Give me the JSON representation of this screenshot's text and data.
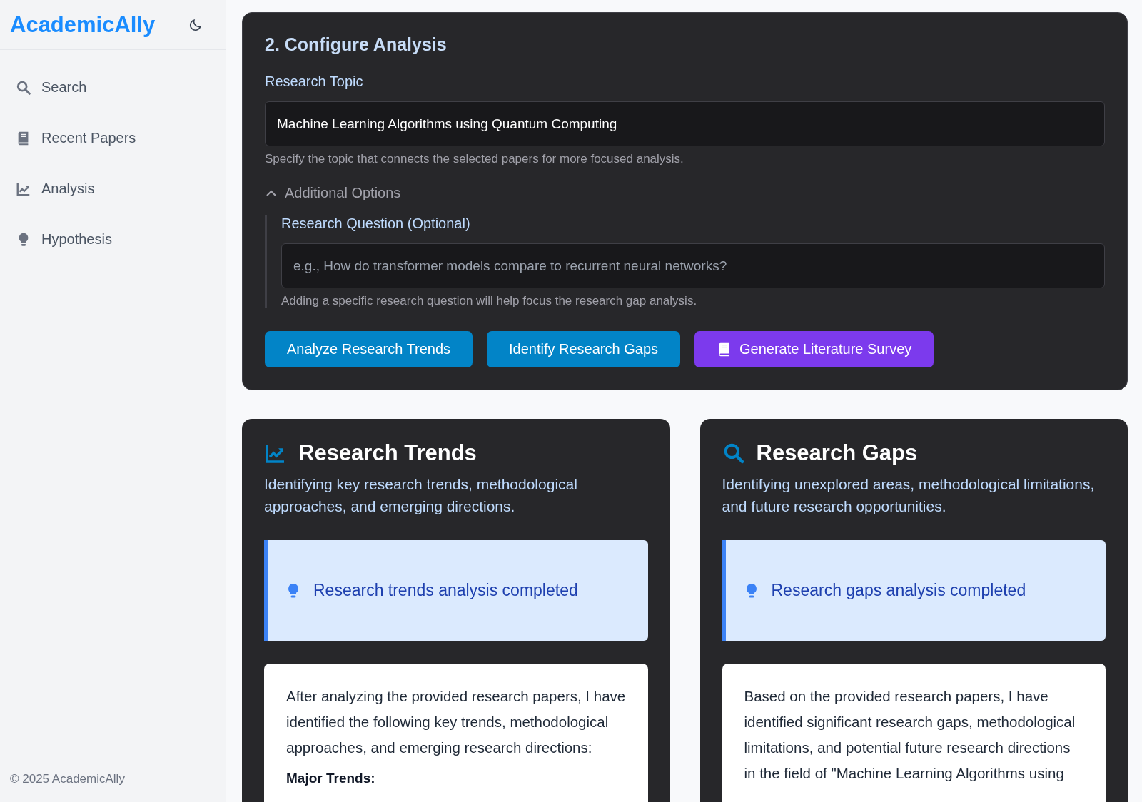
{
  "sidebar": {
    "brand": "AcademicAlly",
    "theme_toggle": {
      "dark": false
    },
    "items": [
      {
        "label": "Search",
        "kind": "search",
        "selected": false
      },
      {
        "label": "Recent Papers",
        "kind": "papers",
        "selected": false
      },
      {
        "label": "Analysis",
        "kind": "analysis",
        "selected": false
      },
      {
        "label": "Hypothesis",
        "kind": "hypothesis",
        "selected": false
      }
    ],
    "footer": "© 2025 AcademicAlly"
  },
  "configure": {
    "title": "2. Configure Analysis",
    "topic_label": "Research Topic",
    "topic_value": "Machine Learning Algorithms using Quantum Computing",
    "topic_help": "Specify the topic that connects the selected papers for more focused analysis.",
    "options": {
      "label": "Additional Options",
      "expanded": true,
      "question_label": "Research Question (Optional)",
      "question_placeholder": "e.g., How do transformer models compare to recurrent neural networks?",
      "question_help": "Adding a specific research question will help focus the research gap analysis."
    },
    "buttons": [
      {
        "label": "Analyze Research Trends",
        "kind": "primary"
      },
      {
        "label": "Identify Research Gaps",
        "kind": "primary"
      },
      {
        "label": "Generate Literature Survey",
        "kind": "survey"
      }
    ]
  },
  "panels": [
    {
      "title": "Research Trends",
      "kind": "trends",
      "subtitle": "Identifying key research trends, methodological approaches, and emerging directions.",
      "status": "Research trends analysis completed",
      "body": "After analyzing the provided research papers, I have identified the following key trends, methodological approaches, and emerging research directions:",
      "heading": "Major Trends:"
    },
    {
      "title": "Research Gaps",
      "kind": "gaps",
      "subtitle": "Identifying unexplored areas, methodological limitations, and future research opportunities.",
      "status": "Research gaps analysis completed",
      "body": "Based on the provided research papers, I have identified significant research gaps, methodological limitations, and potential future research directions in the field of \"Machine Learning Algorithms using"
    }
  ]
}
